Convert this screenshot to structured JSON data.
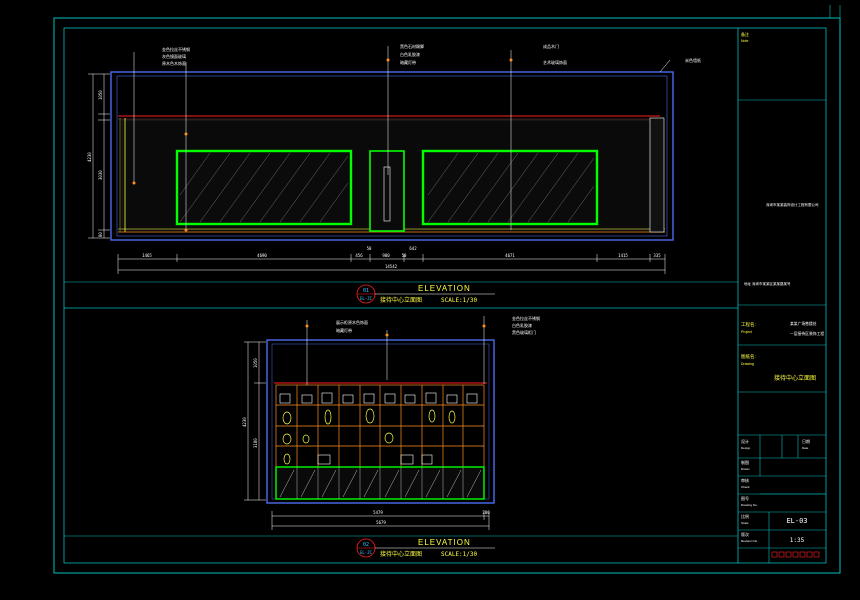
{
  "colors": {
    "background": "#000000",
    "sheet_border": "#00c0c0",
    "frame": "#4a6cf0",
    "cabinet": "#00ff00",
    "dim": "#ffffff",
    "label": "#ffffff",
    "title_yellow": "#ffff40",
    "accent_red": "#ff2020",
    "leader_orange": "#ff9020",
    "tag_blue": "#40c0ff"
  },
  "elevation_top": {
    "heading": "ELEVATION",
    "tag_number": "01",
    "tag_sheet": "EL-ZC",
    "subtitle": "接待中心立面图",
    "scale": "SCALE:1/30",
    "dims_bottom": [
      "1465",
      "4690",
      "456",
      "900",
      "50",
      "4671",
      "1415",
      "335"
    ],
    "dim_total": "14542",
    "dim_mid_extra": [
      "50",
      "642"
    ],
    "dims_left": [
      "1050",
      "4230",
      "3030",
      "80"
    ],
    "notes": [
      "金色拉丝不锈钢",
      "灰色镜面玻璃",
      "原木色木饰面",
      "黑色石材踢脚",
      "白色乳胶漆",
      "暗藏灯带",
      "成品木门",
      "艺术玻璃饰面",
      "米色墙纸"
    ]
  },
  "elevation_bottom": {
    "heading": "ELEVATION",
    "tag_number": "02",
    "tag_sheet": "EL-ZC",
    "subtitle": "接待中心立面图",
    "scale": "SCALE:1/30",
    "dims_bottom": [
      "5479",
      "200"
    ],
    "dim_total": "5679",
    "dims_left": [
      "1050",
      "4230",
      "3180"
    ],
    "notes": [
      "展示柜原木色饰面",
      "暗藏灯带",
      "金色拉丝不锈钢",
      "白色乳胶漆",
      "黑色玻璃柜门"
    ]
  },
  "title_block": {
    "note_label": "备注",
    "note_label_en": "Note",
    "company": "深圳市某某装饰设计工程有限公司",
    "address_line": "地址 深圳市某某区某某路某号",
    "project_label": "工程名:",
    "project_label_en": "Project",
    "project_name": "某某广场售楼处",
    "project_sub": "一层接待区装饰工程",
    "drawing_label": "图纸名:",
    "drawing_label_en": "Drawing",
    "drawing_name": "接待中心立面图",
    "rows": [
      {
        "label": "设计",
        "label_en": "Design",
        "value": "",
        "label2": "日期",
        "label2_en": "Date",
        "value2": ""
      },
      {
        "label": "制图",
        "label_en": "Drawn",
        "value": ""
      },
      {
        "label": "审核",
        "label_en": "Check",
        "value": ""
      },
      {
        "label": "图号",
        "label_en": "Drawing No.",
        "value": "EL-03"
      },
      {
        "label": "比例",
        "label_en": "Scale",
        "value": "1:35"
      },
      {
        "label": "版次",
        "label_en": "Revision No.",
        "value": ""
      }
    ]
  }
}
